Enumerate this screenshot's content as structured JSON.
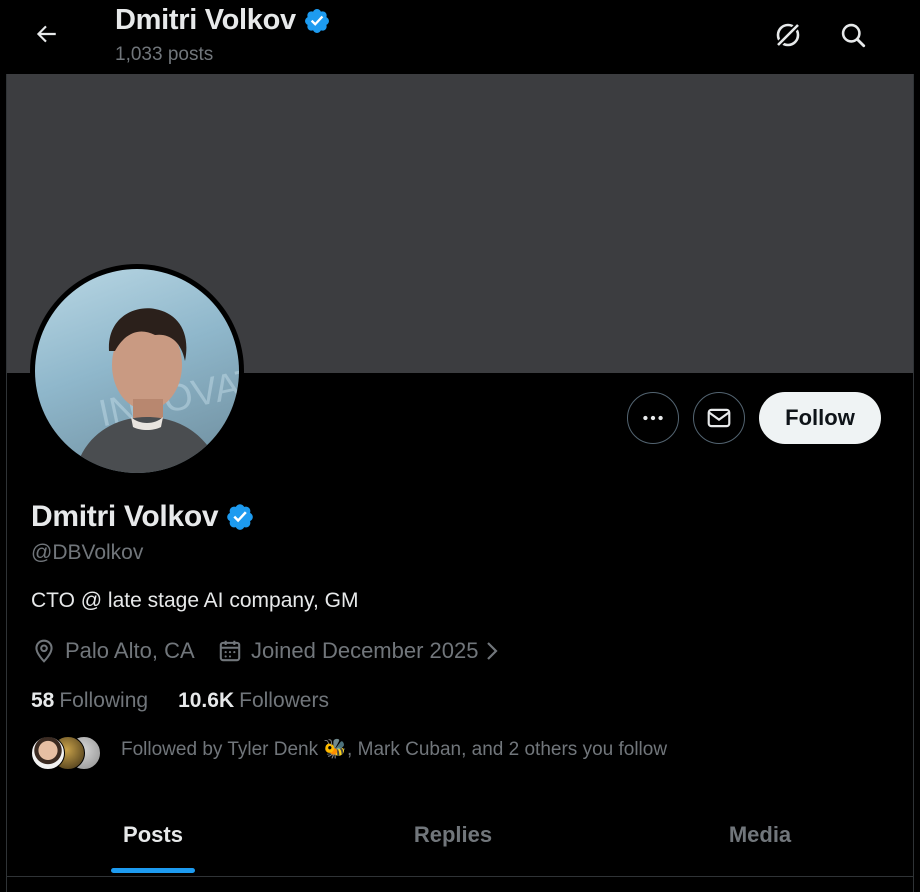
{
  "header": {
    "name": "Dmitri Volkov",
    "post_count": "1,033 posts"
  },
  "profile": {
    "name": "Dmitri Volkov",
    "handle": "@DBVolkov",
    "bio": "CTO @ late stage AI company, GM",
    "location": "Palo Alto, CA",
    "joined": "Joined December 2025",
    "following_count": "58",
    "following_label": "Following",
    "followers_count": "10.6K",
    "followers_label": "Followers",
    "followed_by": "Followed by Tyler Denk 🐝, Mark Cuban, and 2 others you follow"
  },
  "actions": {
    "follow_label": "Follow"
  },
  "tabs": [
    {
      "label": "Posts",
      "active": true
    },
    {
      "label": "Replies",
      "active": false
    },
    {
      "label": "Media",
      "active": false
    }
  ],
  "colors": {
    "verified": "#1d9bf0",
    "accent": "#1d9bf0",
    "banner": "#3c3d40"
  },
  "icons": [
    "back-arrow-icon",
    "grok-icon",
    "search-icon",
    "more-icon",
    "mail-icon",
    "verified-icon",
    "location-icon",
    "calendar-icon",
    "chevron-right-icon"
  ]
}
